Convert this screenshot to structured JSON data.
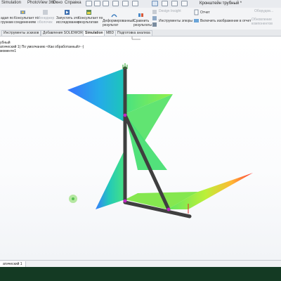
{
  "menu": {
    "items": [
      "Simulation",
      "PhotoView 360",
      "Окно",
      "Справка"
    ]
  },
  "window": {
    "document_title": "Кронштейн трубный *"
  },
  "ribbon": {
    "left_group": [
      "адап по",
      "грузкам"
    ],
    "consultant_connections": [
      "Консультант по",
      "соединениям"
    ],
    "shell_manager": [
      "Менеджер",
      "оболочек"
    ],
    "run_study": [
      "Запустить это",
      "исследование"
    ],
    "consultant_results": [
      "Консультант по",
      "результатам"
    ],
    "deformed_result": [
      "Деформированный",
      "результат"
    ],
    "compare_results": [
      "Сравнить",
      "результаты"
    ],
    "design_insight": "Design Insight",
    "plot_tools": "Инструменты эпюры",
    "report": "Отчет",
    "include_image": "Включить изображение в отчет",
    "update_components": [
      "Обновление",
      "компонентов"
    ],
    "right_top": "Оборудов..."
  },
  "tabs": [
    {
      "label": "Инструменты эскизов",
      "active": false
    },
    {
      "label": "Добавления SOLIDWORKS",
      "active": false
    },
    {
      "label": "Simulation",
      "active": true
    },
    {
      "label": "MBD",
      "active": false
    },
    {
      "label": "Подготовка анализа",
      "active": false
    }
  ],
  "tree": {
    "line1": "убный",
    "line2": "атический 1) По умолчанию <Как обработанный> -)",
    "line3": "моменте1"
  },
  "status": {
    "study_tab": "атический 1"
  },
  "colors": {
    "taskbar": "#143a23",
    "beam": "#3f3f3f",
    "node": "#c426c4",
    "active_tab_bg": "#ffffff"
  }
}
